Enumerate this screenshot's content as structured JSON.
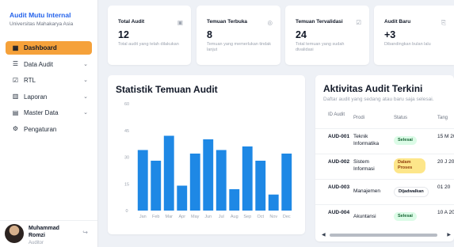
{
  "brand": {
    "name": "Audit Mutu Internal",
    "subtitle": "Universitas Mahakarya Asia"
  },
  "sidebar": {
    "items": [
      {
        "label": "Dashboard",
        "icon": "grid-icon",
        "active": true
      },
      {
        "label": "Data Audit",
        "icon": "database-icon",
        "chevron": true
      },
      {
        "label": "RTL",
        "icon": "clipboard-check-icon",
        "chevron": true
      },
      {
        "label": "Laporan",
        "icon": "bar-chart-icon",
        "chevron": true
      },
      {
        "label": "Master Data",
        "icon": "archive-icon",
        "chevron": true
      },
      {
        "label": "Pengaturan",
        "icon": "gear-icon"
      }
    ]
  },
  "user": {
    "name": "Muhammad Romzi",
    "role": "Auditor"
  },
  "cards": [
    {
      "title": "Total Audit",
      "icon": "clipboard-icon",
      "value": "12",
      "desc": "Total audit yang telah dilakukan"
    },
    {
      "title": "Temuan Terbuka",
      "icon": "alert-circle-icon",
      "value": "8",
      "desc": "Temuan yang memerlukan tindak lanjut"
    },
    {
      "title": "Temuan Tervalidasi",
      "icon": "check-square-icon",
      "value": "24",
      "desc": "Total temuan yang sudah divalidasi"
    },
    {
      "title": "Audit Baru",
      "icon": "file-plus-icon",
      "value": "+3",
      "desc": "Dibandingkan bulan lalu"
    }
  ],
  "chart": {
    "title": "Statistik Temuan Audit"
  },
  "chart_data": {
    "type": "bar",
    "title": "Statistik Temuan Audit",
    "categories": [
      "Jan",
      "Feb",
      "Mar",
      "Apr",
      "May",
      "Jun",
      "Jul",
      "Aug",
      "Sep",
      "Oct",
      "Nov",
      "Dec"
    ],
    "values": [
      34,
      28,
      42,
      14,
      32,
      40,
      34,
      12,
      36,
      28,
      9,
      32
    ],
    "yticks": [
      0,
      15,
      30,
      45,
      60
    ],
    "ylim": [
      0,
      60
    ],
    "xlabel": "",
    "ylabel": "",
    "grid": false,
    "colors": {
      "bar": "#1e88e5"
    }
  },
  "activity": {
    "title": "Aktivitas Audit Terkini",
    "subtitle": "Daftar audit yang sedang atau baru saja selesai.",
    "headers": {
      "id": "ID Audit",
      "prodi": "Prodi",
      "status": "Status",
      "date": "Tang"
    },
    "rows": [
      {
        "id": "AUD-001",
        "prodi": "Teknik Informatika",
        "status": "Selesai",
        "status_kind": "done",
        "date": "15 M 20"
      },
      {
        "id": "AUD-002",
        "prodi": "Sistem Informasi",
        "status": "Dalam Proses",
        "status_kind": "progress",
        "date": "20 J 20"
      },
      {
        "id": "AUD-003",
        "prodi": "Manajemen",
        "status": "Dijadwalkan",
        "status_kind": "scheduled",
        "date": "01 20"
      },
      {
        "id": "AUD-004",
        "prodi": "Akuntansi",
        "status": "Selesai",
        "status_kind": "done",
        "date": "10 A 20"
      }
    ]
  },
  "colors": {
    "accent": "#f5a13a",
    "brand": "#2563eb",
    "bar": "#1e88e5"
  }
}
